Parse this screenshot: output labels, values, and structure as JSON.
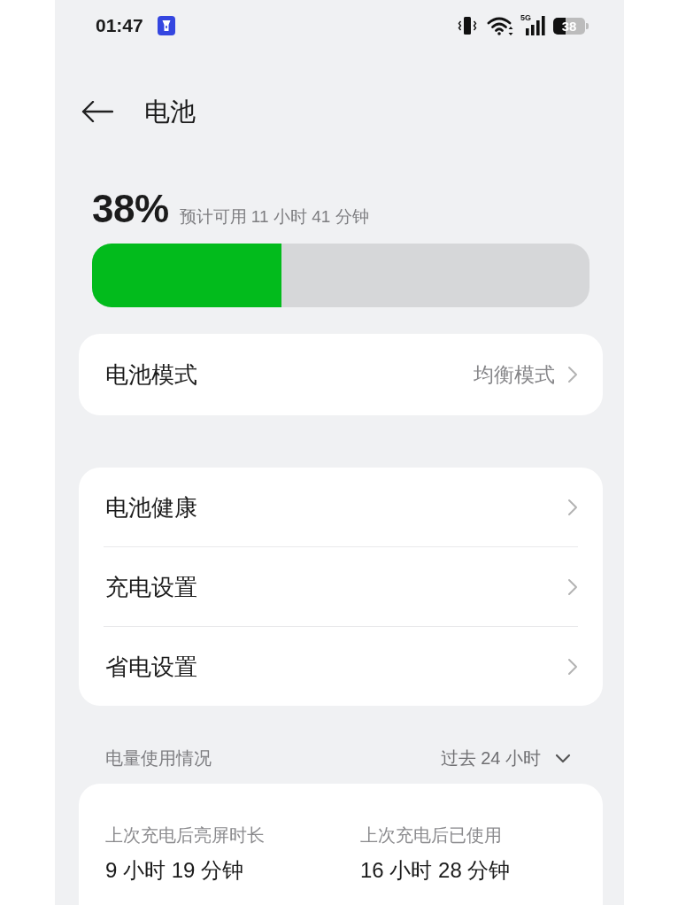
{
  "status_bar": {
    "time": "01:47",
    "network_type": "5G",
    "battery_text": "38"
  },
  "header": {
    "title": "电池"
  },
  "battery": {
    "percent": "38%",
    "estimate": "预计可用 11 小时 41 分钟",
    "level": 0.38
  },
  "mode_card": {
    "rows": [
      {
        "label": "电池模式",
        "value": "均衡模式"
      }
    ]
  },
  "settings_card": {
    "rows": [
      {
        "label": "电池健康"
      },
      {
        "label": "充电设置"
      },
      {
        "label": "省电设置"
      }
    ]
  },
  "usage": {
    "title": "电量使用情况",
    "period": "过去 24 小时",
    "stats": [
      {
        "label": "上次充电后亮屏时长",
        "value": "9 小时 19 分钟"
      },
      {
        "label": "上次充电后已使用",
        "value": "16 小时 28 分钟"
      }
    ]
  }
}
